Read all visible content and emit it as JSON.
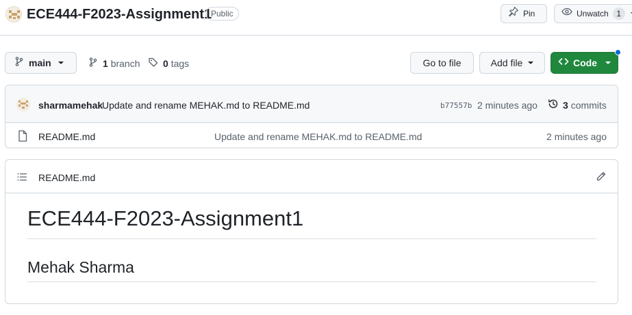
{
  "repo": {
    "name": "ECE444-F2023-Assignment1",
    "visibility": "Public"
  },
  "actions": {
    "pin_label": "Pin",
    "watch_label": "Unwatch",
    "watch_count": "1"
  },
  "toolbar": {
    "branch_selected": "main",
    "branch_count": "1",
    "branch_label": "branch",
    "tag_count": "0",
    "tag_label": "tags",
    "goto_file_label": "Go to file",
    "add_file_label": "Add file",
    "code_label": "Code"
  },
  "latest_commit": {
    "author": "sharmamehak",
    "message": "Update and rename MEHAK.md to README.md",
    "sha": "b77557b",
    "time": "2 minutes ago",
    "commit_count": "3",
    "commit_label": "commits"
  },
  "files": [
    {
      "name": "README.md",
      "message": "Update and rename MEHAK.md to README.md",
      "time": "2 minutes ago"
    }
  ],
  "readme": {
    "filename": "README.md",
    "h1": "ECE444-F2023-Assignment1",
    "h2": "Mehak Sharma"
  },
  "colors": {
    "accent_green": "#1f883d",
    "notification_blue": "#0969da",
    "border": "#d0d7de"
  }
}
